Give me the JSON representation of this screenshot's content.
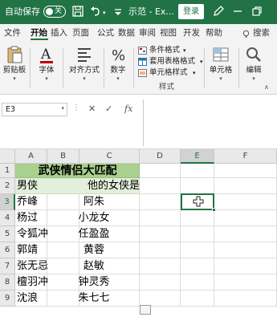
{
  "titlebar": {
    "autosave_label": "自动保存",
    "autosave_state": "关",
    "filename": "示范 - Ex...",
    "login_label": "登录"
  },
  "tabs": [
    "文件",
    "开始",
    "插入",
    "页面",
    "公式",
    "数据",
    "审阅",
    "视图",
    "开发",
    "帮助",
    "搜索"
  ],
  "ribbon": {
    "groups": [
      "剪贴板",
      "字体",
      "对齐方式",
      "数字",
      "单元格",
      "编辑"
    ],
    "styles": {
      "conditional_format": "条件格式",
      "table_format": "套用表格格式",
      "cell_styles": "单元格样式",
      "group_label": "样式"
    }
  },
  "namebox": {
    "value": "E3"
  },
  "formula": {
    "fx_label": "fx"
  },
  "grid": {
    "columns": [
      "A",
      "B",
      "C",
      "D",
      "E",
      "F"
    ],
    "rows": [
      "1",
      "2",
      "3",
      "4",
      "5",
      "6",
      "7",
      "8",
      "9"
    ],
    "selected_cell": "E3",
    "title": "武侠情侣大匹配",
    "header_left": "男侠",
    "header_right": "他的女侠是",
    "men": [
      "乔峰",
      "杨过",
      "令狐冲",
      "郭靖",
      "张无忌",
      "檀羽冲",
      "沈浪"
    ],
    "women": [
      "阿朱",
      "小龙女",
      "任盈盈",
      "黄蓉",
      "赵敏",
      "钟灵秀",
      "朱七七"
    ]
  },
  "colors": {
    "accent": "#217346",
    "title_fill": "#a9d08e",
    "header_fill": "#e2efda"
  }
}
